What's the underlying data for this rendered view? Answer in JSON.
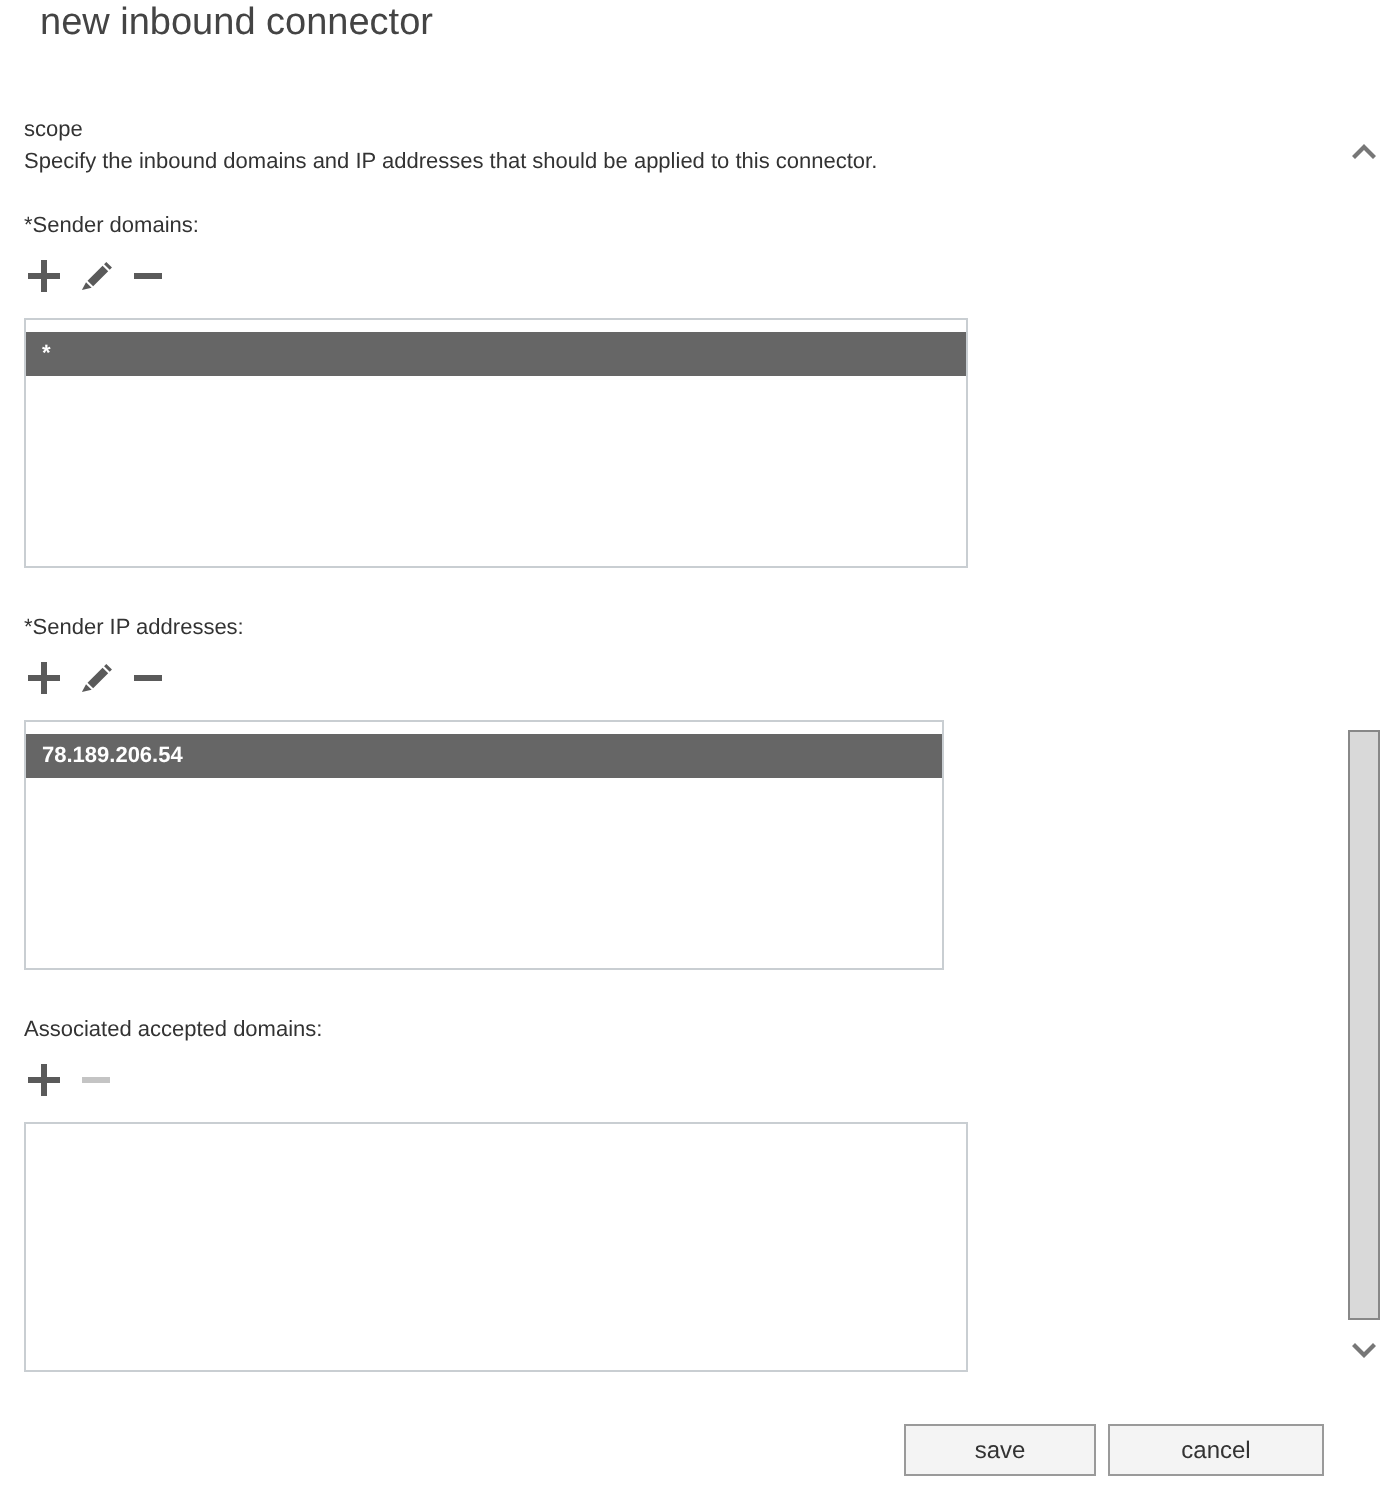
{
  "window": {
    "title": "new inbound connector"
  },
  "section": {
    "heading": "scope",
    "description": "Specify the inbound domains and IP addresses that should be applied to this connector."
  },
  "fields": [
    {
      "label": "*Sender domains:",
      "tools": [
        {
          "kind": "add",
          "disabled": false
        },
        {
          "kind": "edit",
          "disabled": false
        },
        {
          "kind": "remove",
          "disabled": false
        }
      ],
      "items": [
        {
          "text": "*",
          "selected": true
        }
      ]
    },
    {
      "label": "*Sender IP addresses:",
      "tools": [
        {
          "kind": "add",
          "disabled": false
        },
        {
          "kind": "edit",
          "disabled": false
        },
        {
          "kind": "remove",
          "disabled": false
        }
      ],
      "items": [
        {
          "text": "78.189.206.54",
          "selected": true
        }
      ]
    },
    {
      "label": "Associated accepted domains:",
      "tools": [
        {
          "kind": "add",
          "disabled": false
        },
        {
          "kind": "remove",
          "disabled": true
        }
      ]
    }
  ],
  "buttons": [
    {
      "label": "save"
    },
    {
      "label": "cancel"
    }
  ]
}
